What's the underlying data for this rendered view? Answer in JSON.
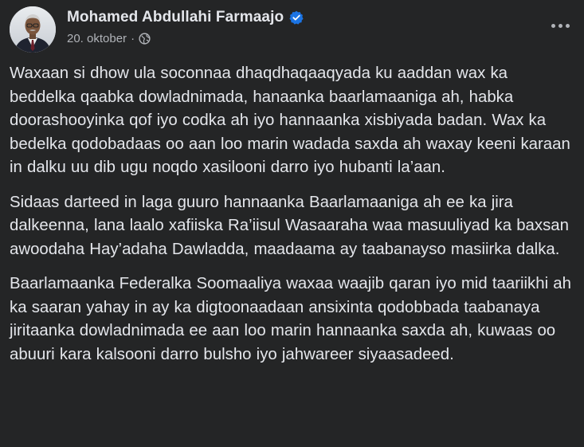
{
  "post": {
    "author": "Mohamed Abdullahi Farmaajo",
    "verified": true,
    "date": "20. oktober",
    "separator": "·",
    "audience_icon": "globe-icon",
    "more_icon": "more-horizontal-icon",
    "paragraphs": [
      "Waxaan si dhow ula soconnaa dhaqdhaqaaqyada ku aaddan wax ka beddelka qaabka dowladnimada, hanaanka baarlamaaniga ah, habka doorashooyinka qof iyo codka ah iyo hannaanka xisbiyada badan. Wax ka bedelka qodobadaas oo aan loo marin wadada saxda ah waxay keeni karaan in dalku uu dib ugu noqdo xasilooni darro iyo hubanti la’aan.",
      "Sidaas darteed in laga guuro hannaanka Baarlamaaniga ah ee ka jira dalkeenna, lana laalo xafiiska Ra’iisul Wasaaraha waa masuuliyad ka baxsan awoodaha Hay’adaha Dawladda, maadaama ay taabanayso masiirka dalka.",
      "Baarlamaanka Federalka Soomaaliya waxaa waajib qaran iyo mid taariikhi ah ka saaran yahay in ay ka digtoonaadaan ansixinta qodobbada taabanaya jiritaanka dowladnimada ee aan loo marin hannaanka saxda ah, kuwaas oo abuuri kara kalsooni darro bulsho iyo jahwareer siyaasadeed."
    ]
  },
  "colors": {
    "background": "#242526",
    "text_primary": "#e4e6eb",
    "text_secondary": "#b0b3b8",
    "verified_badge": "#1b74e4"
  }
}
